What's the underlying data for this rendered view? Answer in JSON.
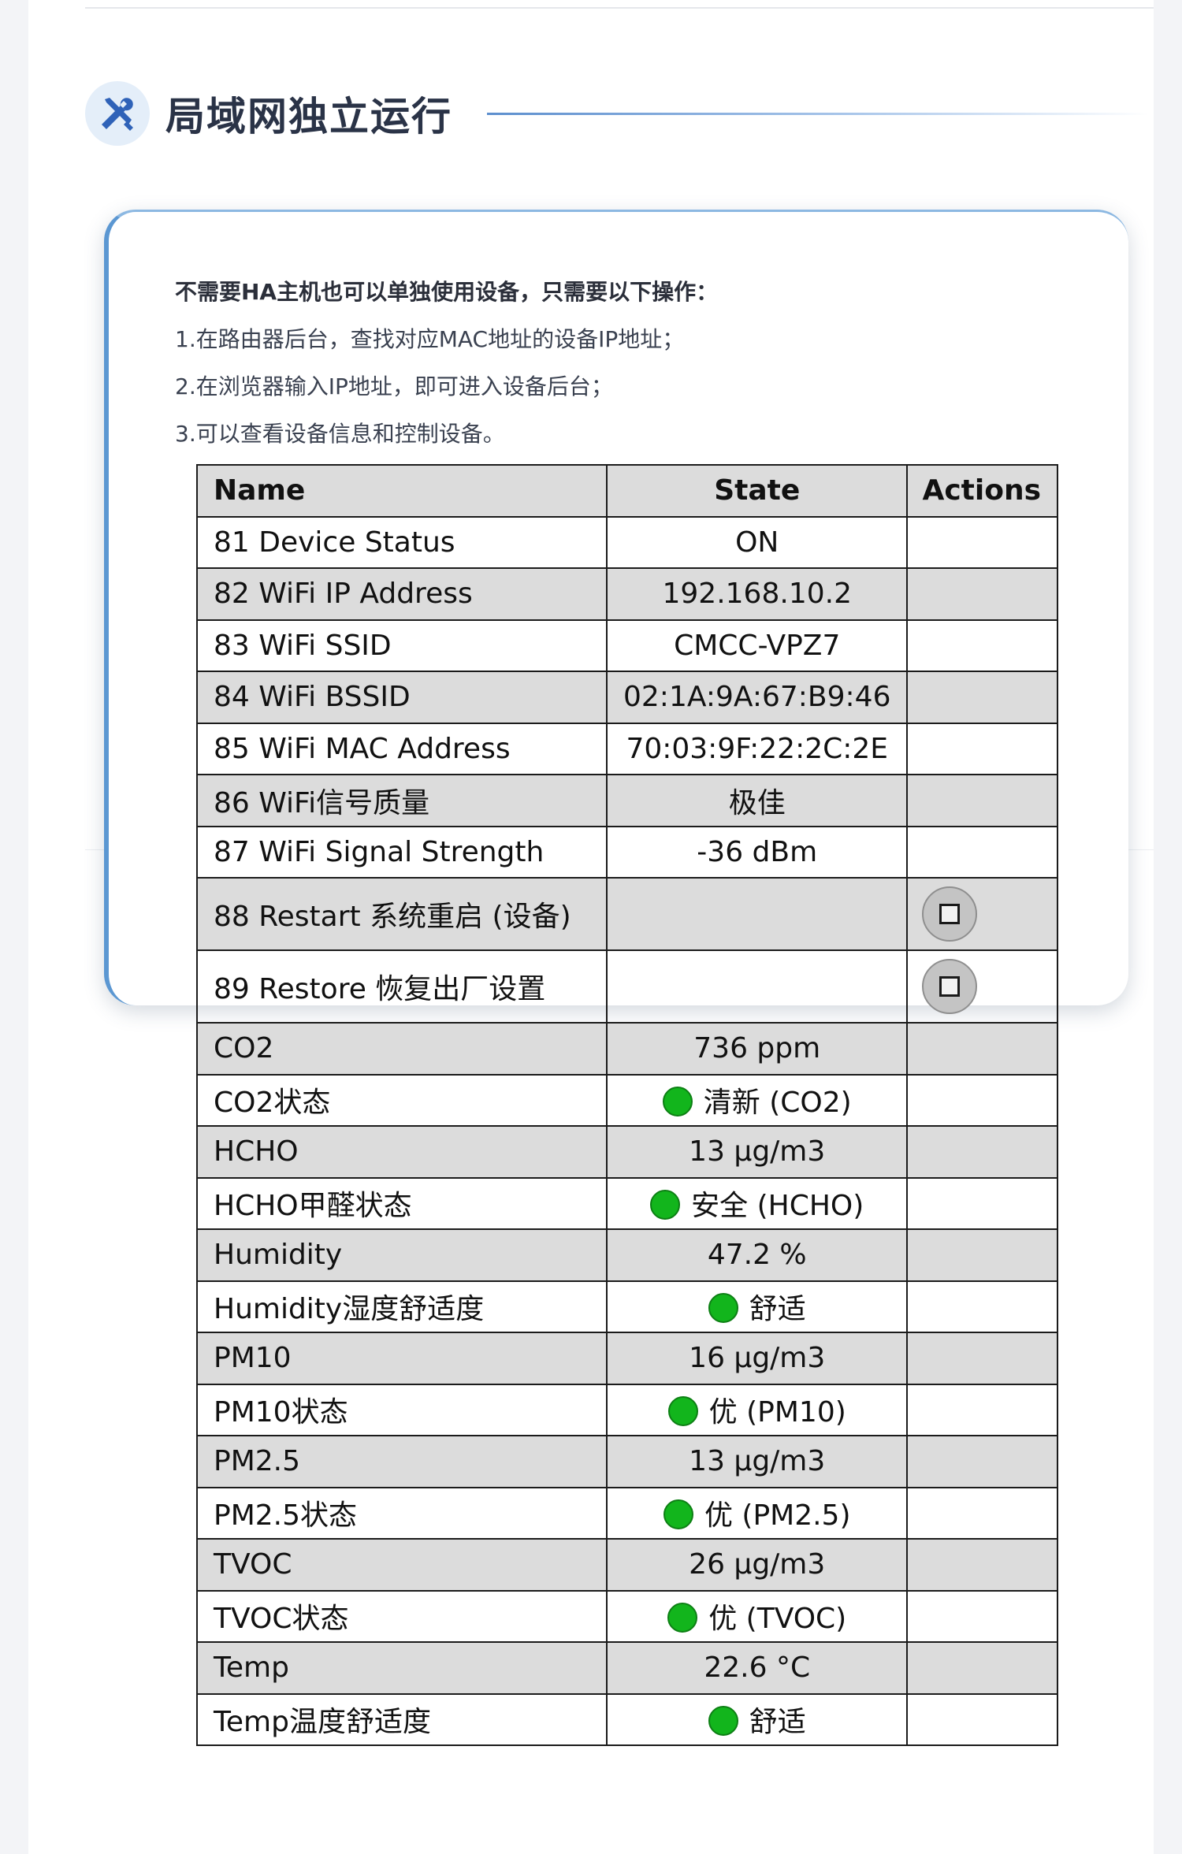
{
  "section": {
    "title": "局域网独立运行",
    "icon": "tools-icon"
  },
  "intro": {
    "lines": [
      "不需要HA主机也可以单独使用设备，只需要以下操作：",
      "1.在路由器后台，查找对应MAC地址的设备IP地址；",
      "2.在浏览器输入IP地址，即可进入设备后台；",
      "3.可以查看设备信息和控制设备。"
    ]
  },
  "table": {
    "headers": [
      "Name",
      "State",
      "Actions"
    ],
    "rows": [
      {
        "name": "81 Device Status",
        "state": "ON"
      },
      {
        "name": "82 WiFi IP Address",
        "state": "192.168.10.2"
      },
      {
        "name": "83 WiFi SSID",
        "state": "CMCC-VPZ7"
      },
      {
        "name": "84 WiFi BSSID",
        "state": "02:1A:9A:67:B9:46"
      },
      {
        "name": "85 WiFi MAC Address",
        "state": "70:03:9F:22:2C:2E"
      },
      {
        "name": "86 WiFi信号质量",
        "state": "极佳"
      },
      {
        "name": "87 WiFi Signal Strength",
        "state": "-36 dBm"
      },
      {
        "name": "88 Restart 系统重启 (设备)",
        "state": "",
        "action": "button-icon"
      },
      {
        "name": "89 Restore 恢复出厂设置",
        "state": "",
        "action": "button-icon"
      },
      {
        "name": "CO2",
        "state": "736 ppm"
      },
      {
        "name": "CO2状态",
        "state": "清新 (CO2)",
        "indicator": "#12b51c"
      },
      {
        "name": "HCHO",
        "state": "13 µg/m3"
      },
      {
        "name": "HCHO甲醛状态",
        "state": "安全 (HCHO)",
        "indicator": "#12b51c"
      },
      {
        "name": "Humidity",
        "state": "47.2 %"
      },
      {
        "name": "Humidity湿度舒适度",
        "state": "舒适",
        "indicator": "#12b51c"
      },
      {
        "name": "PM10",
        "state": "16 µg/m3"
      },
      {
        "name": "PM10状态",
        "state": "优 (PM10)",
        "indicator": "#12b51c"
      },
      {
        "name": "PM2.5",
        "state": "13 µg/m3"
      },
      {
        "name": "PM2.5状态",
        "state": "优 (PM2.5)",
        "indicator": "#12b51c"
      },
      {
        "name": "TVOC",
        "state": "26 µg/m3"
      },
      {
        "name": "TVOC状态",
        "state": "优 (TVOC)",
        "indicator": "#12b51c"
      },
      {
        "name": "Temp",
        "state": "22.6 °C"
      },
      {
        "name": "Temp温度舒适度",
        "state": "舒适",
        "indicator": "#12b51c"
      }
    ]
  },
  "colors": {
    "accent": "#5b97d2",
    "status_good": "#12b51c",
    "row_shade": "#dcdcdc"
  }
}
